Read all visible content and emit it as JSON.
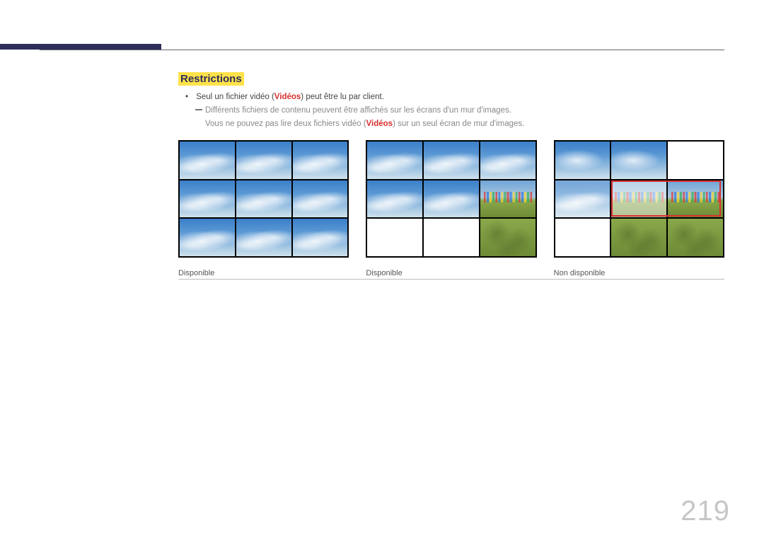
{
  "heading": "Restrictions",
  "bullet": {
    "prefix": "Seul un fichier vidéo (",
    "highlight": "Vidéos",
    "suffix": ") peut être lu par client."
  },
  "sub1": "Différents fichiers de contenu peuvent être affichés sur les écrans d'un mur d'images.",
  "sub2": {
    "prefix": "Vous ne pouvez pas lire deux fichiers vidéo (",
    "highlight": "Vidéos",
    "suffix": ") sur un seul écran de mur d'images."
  },
  "captions": [
    "Disponible",
    "Disponible",
    "Non disponible"
  ],
  "page_number": "219"
}
